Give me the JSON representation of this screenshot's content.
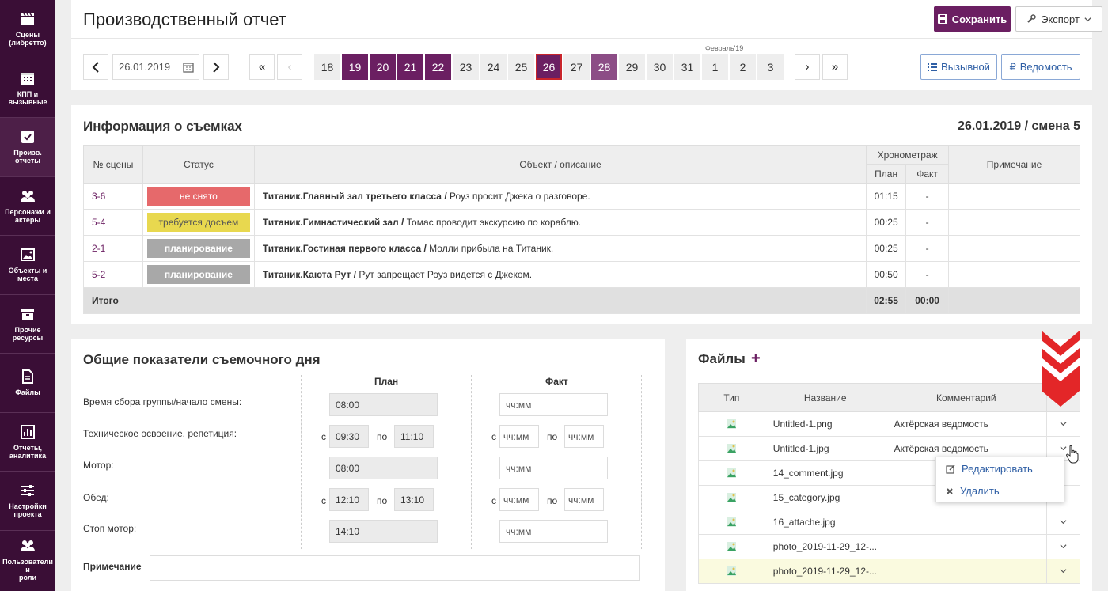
{
  "sidebar": [
    {
      "icon": "clapperboard-icon",
      "label": "Сцены\n(либретто)"
    },
    {
      "icon": "calendar-icon",
      "label": "КПП и\nвызывные"
    },
    {
      "icon": "checkbox-icon",
      "label": "Произв.\nотчеты"
    },
    {
      "icon": "people-icon",
      "label": "Персонажи и\nактеры"
    },
    {
      "icon": "image-icon",
      "label": "Объекты и\nместа"
    },
    {
      "icon": "box-icon",
      "label": "Прочие\nресурсы"
    },
    {
      "icon": "file-icon",
      "label": "Файлы"
    },
    {
      "icon": "chart-icon",
      "label": "Отчеты,\nаналитика"
    },
    {
      "icon": "sliders-icon",
      "label": "Настройки\nпроекта"
    },
    {
      "icon": "users-icon",
      "label": "Пользователи и\nроли"
    }
  ],
  "header": {
    "title": "Производственный отчет",
    "save": "Сохранить",
    "export": "Экспорт"
  },
  "nav": {
    "date": "26.01.2019",
    "first": "«",
    "prev_disabled": "‹",
    "next": "›",
    "last": "»",
    "month_label": "Февраль'19",
    "days": [
      "18",
      "19",
      "20",
      "21",
      "22",
      "23",
      "24",
      "25",
      "26",
      "27",
      "28",
      "29",
      "30",
      "31",
      "1",
      "2",
      "3"
    ],
    "btn_call": "Вызывной",
    "btn_sheet": "Ведомость"
  },
  "info": {
    "title": "Информация о съемках",
    "date": "26.01.2019 / смена 5",
    "headers": {
      "scene": "№ сцены",
      "status": "Статус",
      "object": "Объект / описание",
      "timing": "Хронометраж",
      "plan": "План",
      "fact": "Факт",
      "note": "Примечание"
    },
    "rows": [
      {
        "scene": "3-6",
        "status": "не снято",
        "object_bold": "Титаник.Главный зал третьего класса /",
        "object_text": " Роуз просит Джека о разговоре.",
        "plan": "01:15",
        "fact": "-"
      },
      {
        "scene": "5-4",
        "status": "требуется досъем",
        "object_bold": "Титаник.Гимнастический зал /",
        "object_text": " Томас проводит экскурсию по кораблю.",
        "plan": "00:25",
        "fact": "-"
      },
      {
        "scene": "2-1",
        "status": "планирование",
        "object_bold": "Титаник.Гостиная первого класса /",
        "object_text": " Молли прибыла на Титаник.",
        "plan": "00:25",
        "fact": "-"
      },
      {
        "scene": "5-2",
        "status": "планирование",
        "object_bold": "Титаник.Каюта Рут /",
        "object_text": " Рут запрещает Роуз видется с Джеком.",
        "plan": "00:50",
        "fact": "-"
      }
    ],
    "total": {
      "label": "Итого",
      "plan": "02:55",
      "fact": "00:00"
    },
    "status_colors": {
      "red": "#e6696b",
      "yellow": "#e8d84f",
      "gray": "#a8a8a8"
    }
  },
  "day": {
    "title": "Общие показатели съемочного дня",
    "col_plan": "План",
    "col_fact": "Факт",
    "rows": [
      "Время сбора группы/начало смены:",
      "Техническое освоение, репетиция:",
      "Мотор:",
      "Обед:",
      "Стоп мотор:"
    ],
    "from": "с",
    "to": "по",
    "plan_gather": "08:00",
    "plan_tech_from": "09:30",
    "plan_tech_to": "11:10",
    "plan_motor": "08:00",
    "plan_lunch_from": "12:10",
    "plan_lunch_to": "13:10",
    "plan_stop": "14:10",
    "placeholder": "чч:мм",
    "note_label": "Примечание"
  },
  "files": {
    "title": "Файлы",
    "add": "+",
    "headers": {
      "type": "Тип",
      "name": "Название",
      "comment": "Комментарий"
    },
    "rows": [
      {
        "name": "Untitled-1.png",
        "comment": "Актёрская ведомость"
      },
      {
        "name": "Untitled-1.jpg",
        "comment": "Актёрская ведомость"
      },
      {
        "name": "14_comment.jpg",
        "comment": ""
      },
      {
        "name": "15_category.jpg",
        "comment": ""
      },
      {
        "name": "16_attache.jpg",
        "comment": ""
      },
      {
        "name": "photo_2019-11-29_12-...",
        "comment": ""
      },
      {
        "name": "photo_2019-11-29_12-...",
        "comment": ""
      }
    ],
    "menu": {
      "edit": "Редактировать",
      "delete": "Удалить"
    }
  },
  "colors": {
    "brand": "#6b1f62",
    "sidebar": "#3a0e36",
    "accent_red": "#e32628",
    "link": "#2f5fa5"
  }
}
